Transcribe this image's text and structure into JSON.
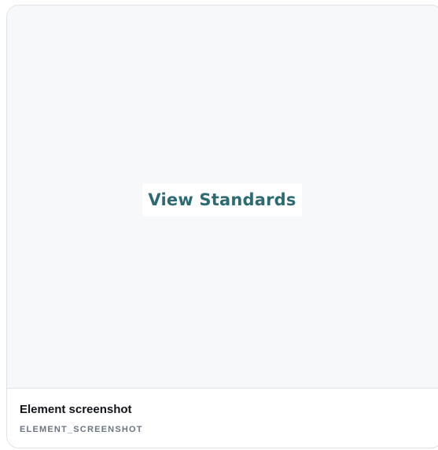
{
  "preview": {
    "button_text": "View Standards",
    "button_text_color": "#2d6b73",
    "background_color": "#f6f8fa"
  },
  "card": {
    "title": "Element screenshot",
    "type_label": "ELEMENT_SCREENSHOT"
  }
}
